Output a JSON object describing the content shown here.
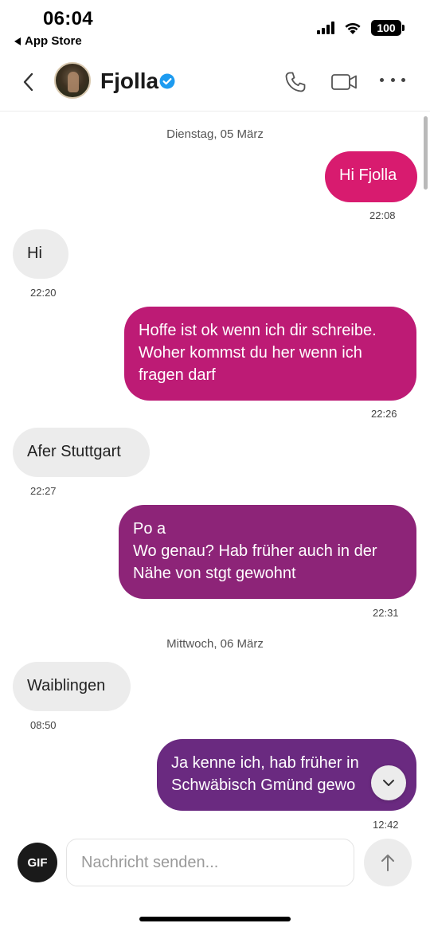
{
  "status_bar": {
    "time": "06:04",
    "back_app": "App Store",
    "battery": "100"
  },
  "header": {
    "contact_name": "Fjolla"
  },
  "messages": [
    {
      "type": "day",
      "text": "Dienstag, 05 März"
    },
    {
      "type": "out",
      "lines": [
        "Hi Fjolla"
      ],
      "time": "22:08",
      "color": "#d81b6f"
    },
    {
      "type": "in",
      "lines": [
        "Hi"
      ],
      "time": "22:20"
    },
    {
      "type": "out",
      "lines": [
        "Hoffe ist ok wenn ich dir schreibe.",
        "Woher kommst du her wenn ich",
        "fragen darf"
      ],
      "time": "22:26",
      "color": "#bd1b75"
    },
    {
      "type": "in",
      "lines": [
        "Afer Stuttgart"
      ],
      "time": "22:27"
    },
    {
      "type": "out",
      "lines": [
        "Po a",
        "Wo genau? Hab früher auch in der",
        "Nähe von stgt gewohnt"
      ],
      "time": "22:31",
      "color": "#8d2478"
    },
    {
      "type": "day",
      "text": "Mittwoch, 06 März"
    },
    {
      "type": "in",
      "lines": [
        "Waiblingen"
      ],
      "time": "08:50"
    },
    {
      "type": "out",
      "lines": [
        "Ja kenne ich, hab früher in",
        "Schwäbisch Gmünd gewo"
      ],
      "time": "12:42",
      "color": "#6a2a80"
    }
  ],
  "composer": {
    "gif_label": "GIF",
    "placeholder": "Nachricht senden..."
  },
  "colors": {
    "accent_verified": "#1d9bf0",
    "incoming_bubble": "#ececec"
  }
}
